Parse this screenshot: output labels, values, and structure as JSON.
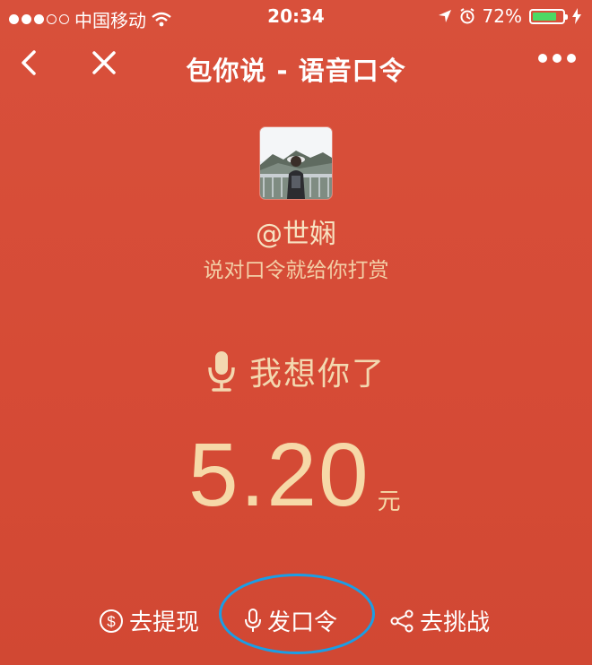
{
  "status_bar": {
    "carrier": "中国移动",
    "time": "20:34",
    "battery_percent": "72%",
    "battery_level": 0.72
  },
  "nav": {
    "title": "包你说 - 语音口令"
  },
  "sender": {
    "name": "@世娴",
    "subtitle": "说对口令就给你打赏"
  },
  "voice_command": {
    "text": "我想你了"
  },
  "amount": {
    "value": "5.20",
    "unit": "元"
  },
  "actions": {
    "withdraw": "去提现",
    "send_command": "发口令",
    "challenge": "去挑战"
  },
  "colors": {
    "background": "#d64e34",
    "accent_gold": "#f6d9a8",
    "highlight_ring": "#1a9ee6"
  }
}
